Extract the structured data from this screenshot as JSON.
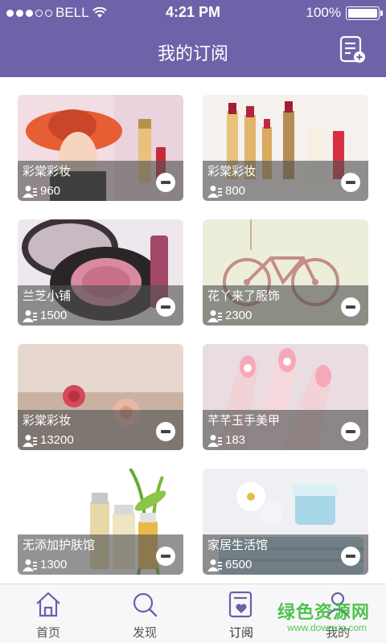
{
  "status_bar": {
    "carrier": "BELL",
    "time": "4:21 PM",
    "battery": "100%",
    "battery_level": 1.0
  },
  "nav": {
    "title": "我的订阅"
  },
  "subscriptions": [
    {
      "name": "彩棠彩妆",
      "count": "960"
    },
    {
      "name": "彩棠彩妆",
      "count": "800"
    },
    {
      "name": "兰芝小铺",
      "count": "1500"
    },
    {
      "name": "花丫来了服饰",
      "count": "2300"
    },
    {
      "name": "彩棠彩妆",
      "count": "13200"
    },
    {
      "name": "芊芊玉手美甲",
      "count": "183"
    },
    {
      "name": "无添加护肤馆",
      "count": "1300"
    },
    {
      "name": "家居生活馆",
      "count": "6500"
    }
  ],
  "tabs": [
    {
      "label": "首页",
      "icon": "home-icon"
    },
    {
      "label": "发现",
      "icon": "search-icon"
    },
    {
      "label": "订阅",
      "icon": "subscribe-icon",
      "active": true
    },
    {
      "label": "我的",
      "icon": "person-icon"
    }
  ],
  "watermark": {
    "text": "绿色资源网",
    "url": "www.downxia.com"
  },
  "colors": {
    "primary": "#7062a8",
    "tab_active": "#6b5fa8"
  }
}
